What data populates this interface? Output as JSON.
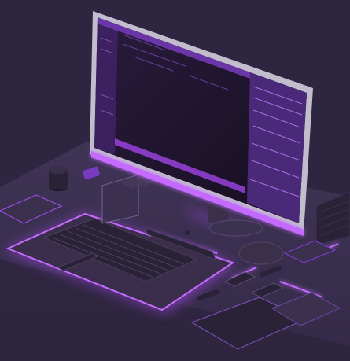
{
  "scene": {
    "subject": "isometric-desk-workstation",
    "style": "3d-render",
    "lighting": "purple-neon-underglow"
  },
  "colors": {
    "background": "#2e2540",
    "desk_top": "#3b3150",
    "desk_edge": "#4a3a66",
    "neon": "#b14cff",
    "neon_soft": "#8a3be0",
    "screen_dark": "#1a1326",
    "screen_panel": "#3a2458",
    "monitor_frame": "#b8b3c4",
    "device_dark": "#2a2236"
  },
  "objects": [
    {
      "name": "monitor",
      "icon": "monitor-icon"
    },
    {
      "name": "keyboard",
      "icon": "keyboard-icon"
    },
    {
      "name": "mouse",
      "icon": "mouse-icon"
    },
    {
      "name": "mug",
      "icon": "mug-icon"
    },
    {
      "name": "glass-stand",
      "icon": "stand-icon"
    },
    {
      "name": "tablet",
      "icon": "tablet-icon"
    },
    {
      "name": "phone",
      "icon": "phone-icon"
    },
    {
      "name": "speaker",
      "icon": "speaker-icon"
    }
  ]
}
